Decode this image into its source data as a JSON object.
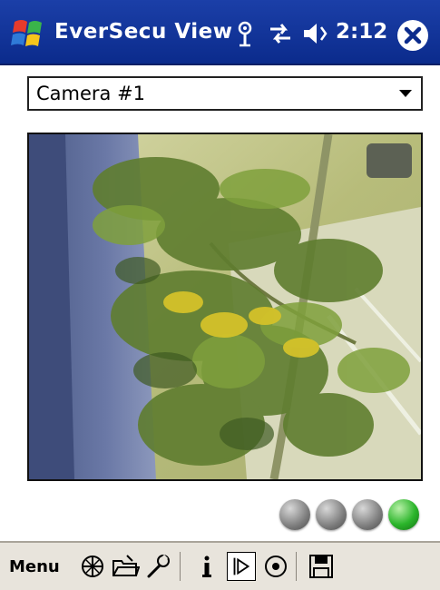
{
  "titlebar": {
    "title": "EverSecu View",
    "time": "2:12",
    "icons": [
      "windows-start-icon",
      "antenna-icon",
      "connectivity-icon",
      "volume-icon",
      "close-icon"
    ],
    "color": "#1b3fa8"
  },
  "camera_selector": {
    "selected": "Camera #1"
  },
  "video": {
    "description_icon": "camera-feed"
  },
  "status_lights": {
    "colors": [
      "#7d7d7d",
      "#7d7d7d",
      "#7d7d7d",
      "#2bb52b"
    ]
  },
  "menubar": {
    "menu_label": "Menu",
    "tools": [
      "ptz-icon",
      "open-folder-icon",
      "settings-wrench-icon",
      "info-icon",
      "play-icon",
      "target-icon",
      "save-disk-icon"
    ]
  }
}
